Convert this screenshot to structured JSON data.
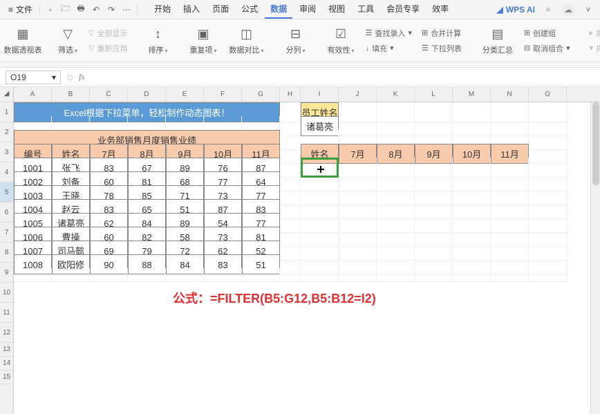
{
  "titlebar": {
    "file": "文件",
    "tabs": [
      "开始",
      "插入",
      "页面",
      "公式",
      "数据",
      "审阅",
      "视图",
      "工具",
      "会员专享",
      "效率"
    ],
    "active_tab": "数据",
    "ai": "WPS AI"
  },
  "ribbon": {
    "pivot": "数据透视表",
    "filter": "筛选",
    "show_all": "全部显示",
    "reapply": "重新应用",
    "sort": "排序",
    "dup": "重复项",
    "compare": "数据对比",
    "split": "分列",
    "validity": "有效性",
    "fill": "填充",
    "find_input": "查找录入",
    "consolidate": "合并计算",
    "dropdown_list": "下拉列表",
    "subtotal": "分类汇总",
    "create_group": "创建组",
    "ungroup": "取消组合",
    "expand": "展开",
    "collapse": "折叠"
  },
  "namebox": {
    "cell": "O19",
    "fx": "fx"
  },
  "cols": [
    "A",
    "B",
    "C",
    "D",
    "E",
    "F",
    "G",
    "H",
    "I",
    "J",
    "K",
    "L",
    "M",
    "N",
    "O"
  ],
  "rows": [
    "1",
    "2",
    "3",
    "4",
    "5",
    "6",
    "7",
    "8",
    "9",
    "10",
    "11",
    "12",
    "13",
    "14",
    "15"
  ],
  "banner": "Excel根据下拉菜单，轻松制作动态图表！",
  "left_title": "业务部销售月度销售业绩",
  "left_headers": [
    "编号",
    "姓名",
    "7月",
    "8月",
    "9月",
    "10月",
    "11月"
  ],
  "left_rows": [
    [
      "1001",
      "张飞",
      "83",
      "67",
      "89",
      "76",
      "87"
    ],
    [
      "1002",
      "刘备",
      "60",
      "81",
      "68",
      "77",
      "64"
    ],
    [
      "1003",
      "王晓",
      "78",
      "85",
      "71",
      "73",
      "77"
    ],
    [
      "1004",
      "赵云",
      "83",
      "65",
      "51",
      "87",
      "83"
    ],
    [
      "1005",
      "诸葛亮",
      "62",
      "84",
      "89",
      "54",
      "77"
    ],
    [
      "1006",
      "曹操",
      "60",
      "82",
      "58",
      "73",
      "81"
    ],
    [
      "1007",
      "司马懿",
      "69",
      "79",
      "72",
      "62",
      "52"
    ],
    [
      "1008",
      "欧阳修",
      "90",
      "88",
      "84",
      "83",
      "51"
    ]
  ],
  "emp": {
    "header": "员工姓名",
    "value": "诸葛亮"
  },
  "right_headers": [
    "姓名",
    "7月",
    "8月",
    "9月",
    "10月",
    "11月"
  ],
  "formula": "公式：=FILTER(B5:G12,B5:B12=I2)",
  "chart_data": {
    "type": "table",
    "title": "业务部销售月度销售业绩",
    "categories": [
      "7月",
      "8月",
      "9月",
      "10月",
      "11月"
    ],
    "series": [
      {
        "name": "张飞",
        "id": "1001",
        "values": [
          83,
          67,
          89,
          76,
          87
        ]
      },
      {
        "name": "刘备",
        "id": "1002",
        "values": [
          60,
          81,
          68,
          77,
          64
        ]
      },
      {
        "name": "王晓",
        "id": "1003",
        "values": [
          78,
          85,
          71,
          73,
          77
        ]
      },
      {
        "name": "赵云",
        "id": "1004",
        "values": [
          83,
          65,
          51,
          87,
          83
        ]
      },
      {
        "name": "诸葛亮",
        "id": "1005",
        "values": [
          62,
          84,
          89,
          54,
          77
        ]
      },
      {
        "name": "曹操",
        "id": "1006",
        "values": [
          60,
          82,
          58,
          73,
          81
        ]
      },
      {
        "name": "司马懿",
        "id": "1007",
        "values": [
          69,
          79,
          72,
          62,
          52
        ]
      },
      {
        "name": "欧阳修",
        "id": "1008",
        "values": [
          90,
          88,
          84,
          83,
          51
        ]
      }
    ]
  }
}
